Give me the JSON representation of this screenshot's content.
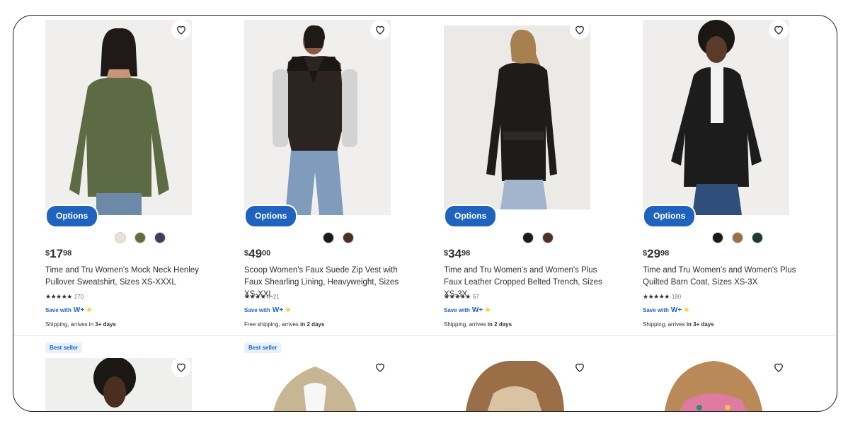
{
  "products": [
    {
      "title": "Time and Tru Women's Mock Neck Henley Pullover Sweatshirt, Sizes XS-XXXL",
      "price_currency": "$",
      "price_dollars": "17",
      "price_cents": "98",
      "rating_count": "270",
      "save_label": "Save with",
      "plus_label": "W+",
      "shipping_prefix": "Shipping, arrives in ",
      "shipping_bold": "3+ days",
      "options_label": "Options",
      "swatches": [
        "#e9e1d3",
        "#5e6e3f",
        "#3c3f5e"
      ],
      "image_bg": "#f0efed",
      "garment": "#5d6b44"
    },
    {
      "title": "Scoop Women's Faux Suede Zip Vest with Faux Shearling Lining, Heavyweight, Sizes XS-XXL",
      "price_currency": "$",
      "price_dollars": "49",
      "price_cents": "00",
      "rating_count": "21",
      "save_label": "Save with",
      "plus_label": "W+",
      "shipping_prefix": "Free shipping, arrives ",
      "shipping_bold": "in 2 days",
      "options_label": "Options",
      "swatches": [
        "#1b1b1b",
        "#4a3020"
      ],
      "image_bg": "#f1efed",
      "garment": "#2b2421"
    },
    {
      "title": "Time and Tru Women's and Women's Plus Faux Leather Cropped Belted Trench, Sizes XS-3X",
      "price_currency": "$",
      "price_dollars": "34",
      "price_cents": "98",
      "rating_count": "67",
      "save_label": "Save with",
      "plus_label": "W+",
      "shipping_prefix": "Shipping, arrives ",
      "shipping_bold": "in 2 days",
      "options_label": "Options",
      "swatches": [
        "#1b1b1b",
        "#4b3327"
      ],
      "image_bg": "#eceae7",
      "garment": "#1e1c1b"
    },
    {
      "title": "Time and Tru Women's and Women's Plus Quilted Barn Coat, Sizes XS-3X",
      "price_currency": "$",
      "price_dollars": "29",
      "price_cents": "98",
      "rating_count": "180",
      "save_label": "Save with",
      "plus_label": "W+",
      "shipping_prefix": "Shipping, arrives ",
      "shipping_bold": "in 3+ days",
      "options_label": "Options",
      "swatches": [
        "#1b1b1b",
        "#9a7048",
        "#1e3b33"
      ],
      "image_bg": "#efeeec",
      "garment": "#1c1c1d"
    }
  ],
  "second_row": [
    {
      "badge": "Best seller",
      "image_bg": "#efefed"
    },
    {
      "badge": "Best seller",
      "image_bg": "#ffffff"
    },
    {
      "badge": "",
      "image_bg": "#ffffff"
    },
    {
      "badge": "",
      "image_bg": "#ffffff"
    }
  ],
  "icons": {
    "favorite": "heart-outline-icon"
  },
  "colors": {
    "accent": "#1f63bf",
    "badge_bg": "#e6f1fc",
    "walmart_spark": "#ffc220"
  }
}
